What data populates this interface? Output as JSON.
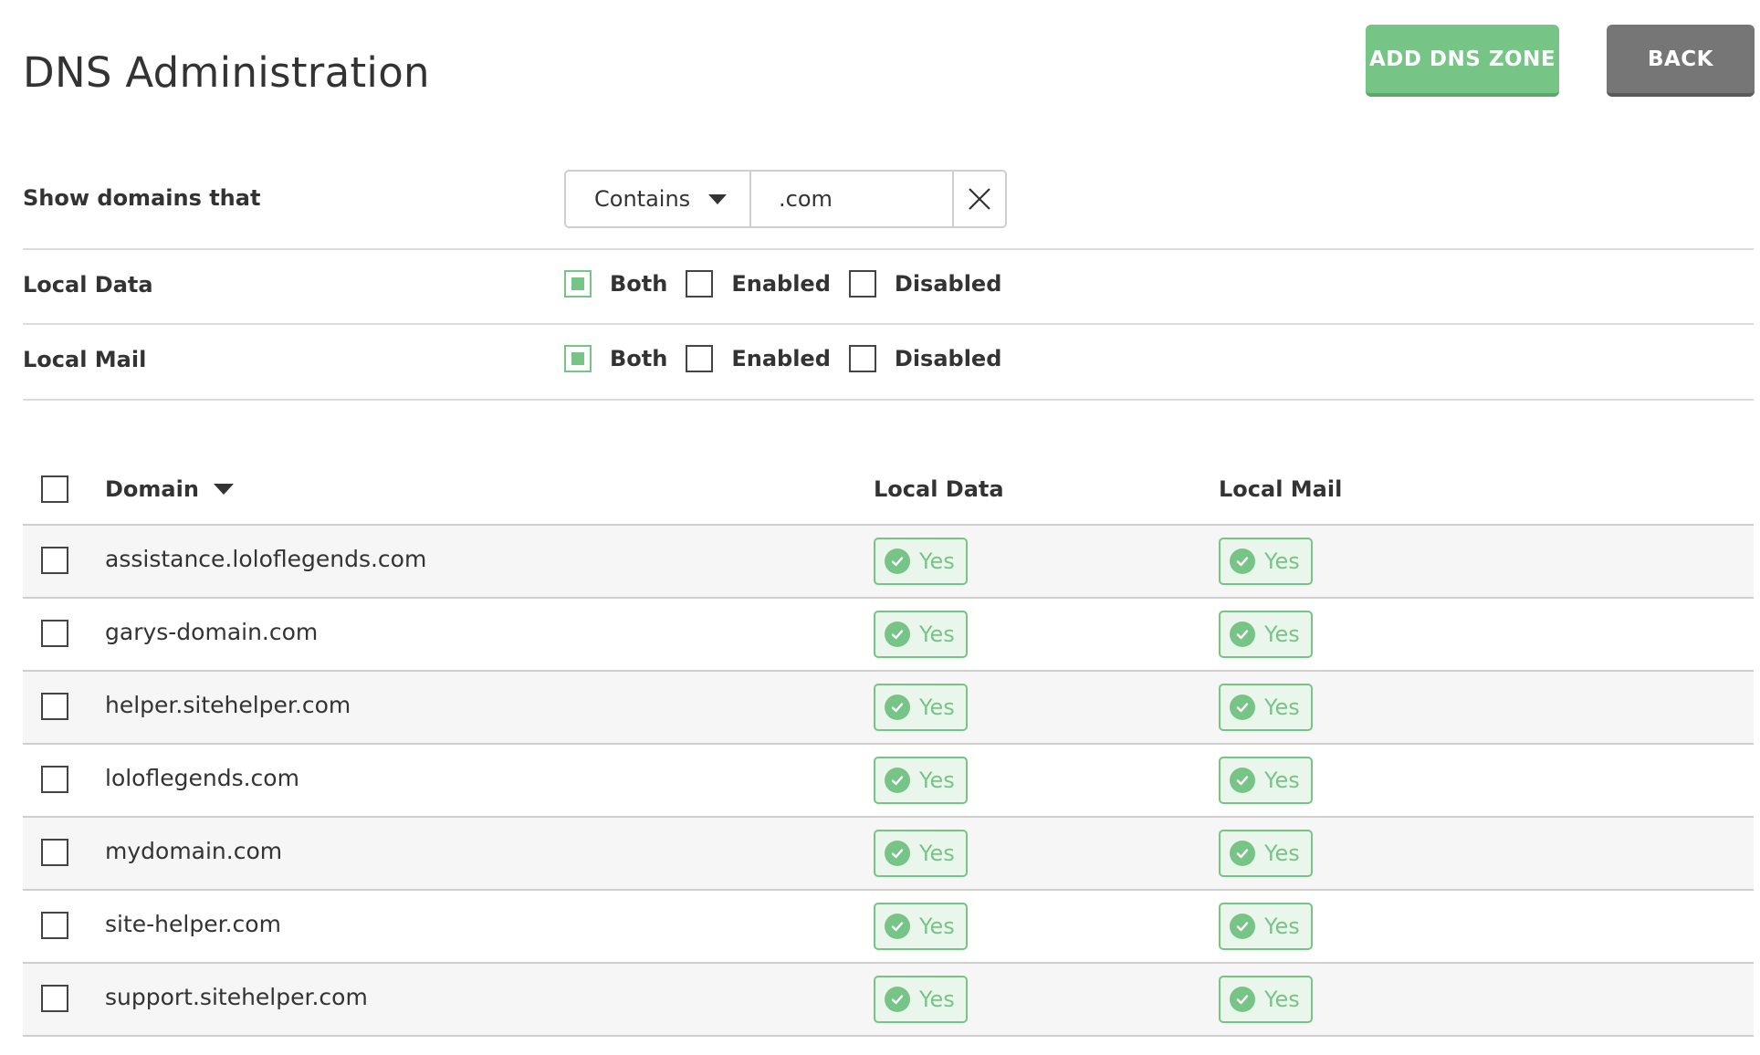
{
  "page_title": "DNS Administration",
  "header": {
    "add_label": "ADD DNS ZONE",
    "back_label": "BACK"
  },
  "colors": {
    "accent": "#76c486",
    "back": "#767676",
    "badge_bg": "#eaf6ec",
    "row_alt": "#f6f6f6"
  },
  "filters": {
    "show_label": "Show domains that",
    "operator": "Contains",
    "value": ".com",
    "local_data": {
      "label": "Local Data",
      "options": [
        "Both",
        "Enabled",
        "Disabled"
      ],
      "selected": "Both"
    },
    "local_mail": {
      "label": "Local Mail",
      "options": [
        "Both",
        "Enabled",
        "Disabled"
      ],
      "selected": "Both"
    }
  },
  "table": {
    "headers": {
      "domain": "Domain",
      "local_data": "Local Data",
      "local_mail": "Local Mail"
    },
    "rows": [
      {
        "domain": "assistance.loloflegends.com",
        "local_data": "Yes",
        "local_mail": "Yes"
      },
      {
        "domain": "garys-domain.com",
        "local_data": "Yes",
        "local_mail": "Yes"
      },
      {
        "domain": "helper.sitehelper.com",
        "local_data": "Yes",
        "local_mail": "Yes"
      },
      {
        "domain": "loloflegends.com",
        "local_data": "Yes",
        "local_mail": "Yes"
      },
      {
        "domain": "mydomain.com",
        "local_data": "Yes",
        "local_mail": "Yes"
      },
      {
        "domain": "site-helper.com",
        "local_data": "Yes",
        "local_mail": "Yes"
      },
      {
        "domain": "support.sitehelper.com",
        "local_data": "Yes",
        "local_mail": "Yes"
      }
    ]
  }
}
